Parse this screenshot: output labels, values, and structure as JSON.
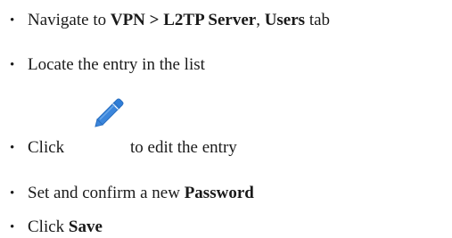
{
  "steps": [
    {
      "prefix": "Navigate to ",
      "bold1": "VPN > L2TP Server",
      "mid": ", ",
      "bold2": "Users",
      "suffix": " tab"
    },
    {
      "text": "Locate the entry in the list"
    },
    {
      "prefix": "Click",
      "icon": "pencil-edit-icon",
      "suffix": "to edit the entry"
    },
    {
      "prefix": "Set and confirm a new ",
      "bold": "Password"
    },
    {
      "prefix": "Click ",
      "bold": "Save"
    }
  ],
  "colors": {
    "text": "#1a1a1a",
    "icon": "#2f7ed8"
  }
}
